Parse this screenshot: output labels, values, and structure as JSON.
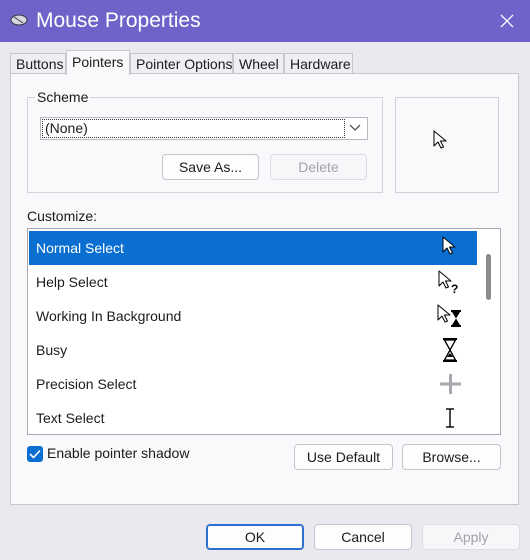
{
  "window": {
    "title": "Mouse Properties",
    "accent_color": "#6f63c9",
    "icons": {
      "app": "mouse-icon",
      "close": "close-icon"
    }
  },
  "tabs": [
    {
      "label": "Buttons",
      "active": false
    },
    {
      "label": "Pointers",
      "active": true
    },
    {
      "label": "Pointer Options",
      "active": false
    },
    {
      "label": "Wheel",
      "active": false
    },
    {
      "label": "Hardware",
      "active": false
    }
  ],
  "scheme": {
    "legend": "Scheme",
    "selected_value": "(None)",
    "save_as_label": "Save As...",
    "delete_label": "Delete",
    "preview_icon": "arrow-cursor-icon"
  },
  "customize": {
    "label": "Customize:",
    "selection_color": "#0a6fd1",
    "items": [
      {
        "label": "Normal Select",
        "icon": "arrow-cursor-icon",
        "selected": true
      },
      {
        "label": "Help Select",
        "icon": "help-cursor-icon",
        "selected": false
      },
      {
        "label": "Working In Background",
        "icon": "working-cursor-icon",
        "selected": false
      },
      {
        "label": "Busy",
        "icon": "hourglass-cursor-icon",
        "selected": false
      },
      {
        "label": "Precision Select",
        "icon": "crosshair-cursor-icon",
        "selected": false
      },
      {
        "label": "Text Select",
        "icon": "text-cursor-icon",
        "selected": false
      }
    ]
  },
  "options": {
    "enable_shadow_label": "Enable pointer shadow",
    "enable_shadow_checked": true,
    "use_default_label": "Use Default",
    "browse_label": "Browse..."
  },
  "footer": {
    "ok_label": "OK",
    "cancel_label": "Cancel",
    "apply_label": "Apply"
  }
}
